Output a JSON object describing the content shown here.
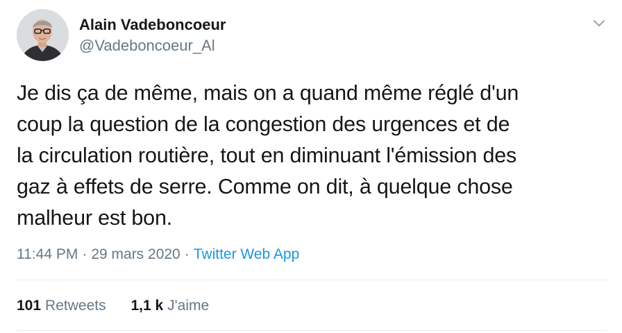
{
  "author": {
    "display_name": "Alain Vadeboncoeur",
    "handle": "@Vadeboncoeur_Al",
    "avatar_icon": "person-avatar"
  },
  "tweet": {
    "lines": [
      "Je dis ça de même, mais on a quand même réglé d'un",
      "coup la question de la congestion des urgences et de",
      "la circulation routière, tout en diminuant l'émission des",
      "gaz à effets de serre. Comme on dit, à quelque chose",
      "malheur est bon."
    ]
  },
  "meta": {
    "time": "11:44 PM",
    "separator": "·",
    "date": "29 mars 2020",
    "source": "Twitter Web App"
  },
  "stats": {
    "retweets_count": "101",
    "retweets_label": "Retweets",
    "likes_count": "1,1 k",
    "likes_label": "J'aime"
  },
  "menu": {
    "icon": "chevron-down-icon"
  },
  "colors": {
    "text": "#14171a",
    "secondary": "#657786",
    "link": "#1b95e0",
    "divider": "#e6ecf0"
  }
}
